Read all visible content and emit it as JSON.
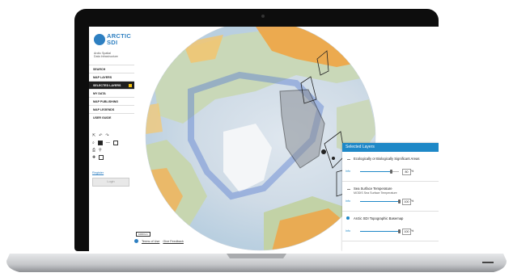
{
  "app": {
    "logo_line1": "ARCTIC",
    "logo_line2": "SDI",
    "subtitle_line1": "Arctic Spatial",
    "subtitle_line2": "Data Infrastructure"
  },
  "menu": {
    "items": [
      {
        "label": "SEARCH"
      },
      {
        "label": "MAP LAYERS"
      },
      {
        "label": "SELECTED LAYERS"
      },
      {
        "label": "MY DATA"
      },
      {
        "label": "MAP PUBLISHING"
      },
      {
        "label": "MAP LEGENDS"
      },
      {
        "label": "USER GUIDE"
      }
    ]
  },
  "sidebar": {
    "register_label": "Register",
    "login_label": "Login"
  },
  "map": {
    "scale_label": "1000 km",
    "terms_label": "Terms of Use",
    "feedback_label": "Give Feedback"
  },
  "panel": {
    "title": "Selected Layers",
    "layers": [
      {
        "name": "Ecologically or Biologically Significant Areas",
        "subtitle": "",
        "link": "Info",
        "opacity": "80",
        "opacity_fraction": 0.8
      },
      {
        "name": "Sea Surface Temperature",
        "subtitle": "MODIS Sea Surface Temperature",
        "link": "Info",
        "opacity": "100",
        "opacity_fraction": 1.0
      },
      {
        "name": "Arctic SDI Topographic Basemap",
        "subtitle": "",
        "link": "Info",
        "opacity": "100",
        "opacity_fraction": 1.0
      }
    ],
    "percent_sign": "%"
  },
  "colors": {
    "accent": "#1e88c7",
    "brand": "#2d7fc1",
    "active_menu": "#1f1f1f",
    "badge": "#f4c20d"
  }
}
